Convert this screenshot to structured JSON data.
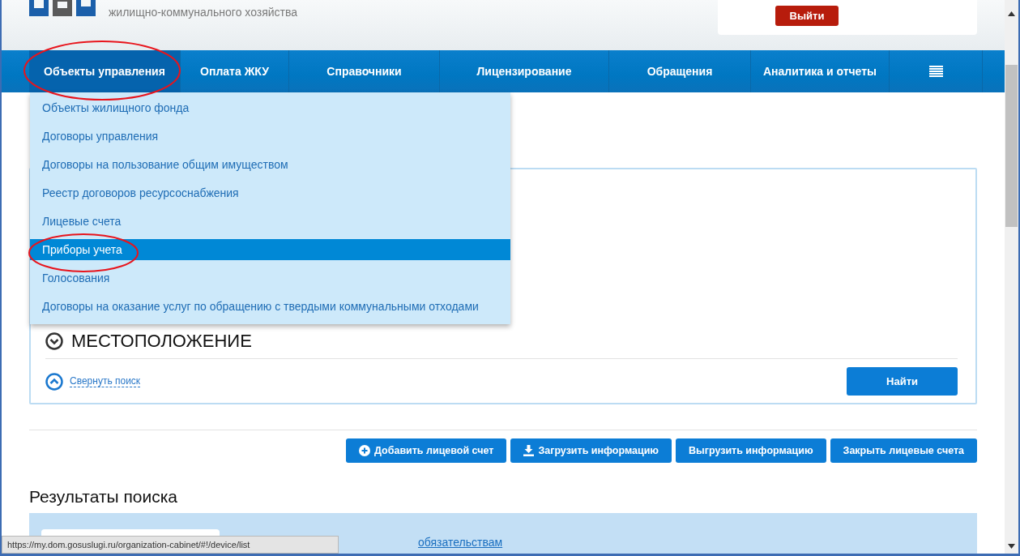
{
  "header": {
    "title_lines": [
      "жилищно-коммунального хозяйства"
    ],
    "logout_button": "Выйти"
  },
  "nav": [
    {
      "label": "Объекты управления",
      "selected": true
    },
    {
      "label": "Оплата ЖКУ",
      "selected": false
    },
    {
      "label": "Справочники",
      "selected": false
    },
    {
      "label": "Лицензирование",
      "selected": false
    },
    {
      "label": "Обращения",
      "selected": false
    },
    {
      "label": "Аналитика и отчеты",
      "selected": false
    }
  ],
  "dropdown": [
    {
      "label": "Объекты жилищного фонда",
      "selected": false
    },
    {
      "label": "Договоры управления",
      "selected": false
    },
    {
      "label": "Договоры на пользование общим имуществом",
      "selected": false
    },
    {
      "label": "Реестр договоров ресурсоснабжения",
      "selected": false
    },
    {
      "label": "Лицевые счета",
      "selected": false
    },
    {
      "label": "Приборы учета",
      "selected": true
    },
    {
      "label": "Голосования",
      "selected": false
    },
    {
      "label": "Договоры на оказание услуг по обращению с твердыми коммунальными отходами",
      "selected": false
    }
  ],
  "search": {
    "section_title": "МЕСТОПОЛОЖЕНИЕ",
    "collapse_link": "Свернуть поиск",
    "find_button": "Найти"
  },
  "actions": [
    {
      "label": "Добавить лицевой счет",
      "kind": "plus"
    },
    {
      "label": "Загрузить информацию",
      "kind": "download"
    },
    {
      "label": "Выгрузить информацию",
      "kind": "plain"
    },
    {
      "label": "Закрыть лицевые счета",
      "kind": "plain"
    }
  ],
  "results": {
    "title": "Результаты поиска",
    "link": "обязательствам"
  },
  "status_url": "https://my.dom.gosuslugi.ru/organization-cabinet/#!/device/list"
}
